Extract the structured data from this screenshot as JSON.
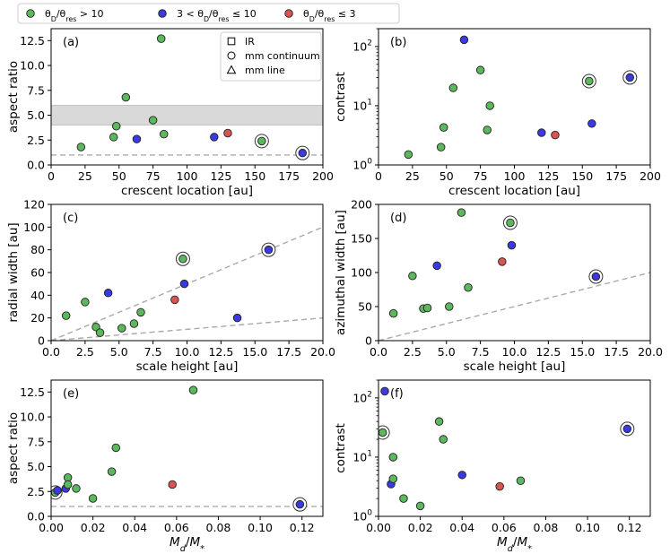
{
  "legend_top": {
    "entries": [
      {
        "label": "θ_D/θ_res > 10",
        "parts": [
          [
            "θ",
            ""
          ],
          [
            "D",
            "sub"
          ],
          [
            "/θ",
            ""
          ],
          [
            "res",
            "sub"
          ],
          [
            " > 10",
            ""
          ]
        ],
        "color": "#5cb85c",
        "key": "g"
      },
      {
        "label": "3 < θ_D/θ_res ≤ 10",
        "parts": [
          [
            "3 < θ",
            ""
          ],
          [
            "D",
            "sub"
          ],
          [
            "/θ",
            ""
          ],
          [
            "res",
            "sub"
          ],
          [
            " ≤ 10",
            ""
          ]
        ],
        "color": "#3a3ae0",
        "key": "b"
      },
      {
        "label": "θ_D/θ_res ≤ 3",
        "parts": [
          [
            "θ",
            ""
          ],
          [
            "D",
            "sub"
          ],
          [
            "/θ",
            ""
          ],
          [
            "res",
            "sub"
          ],
          [
            " ≤ 3",
            ""
          ]
        ],
        "color": "#d9534f",
        "key": "r"
      }
    ]
  },
  "legend_markers": {
    "entries": [
      {
        "label": "IR",
        "marker": "square"
      },
      {
        "label": "mm continuum",
        "marker": "circle"
      },
      {
        "label": "mm line",
        "marker": "triangle"
      }
    ]
  },
  "colors": {
    "g": "#5cb85c",
    "b": "#3a3ae0",
    "r": "#d9534f",
    "edge": "#222222",
    "dashed": "#aaaaaa",
    "band": "#d9d9d9"
  },
  "chart_data": [
    {
      "panel": "(a)",
      "type": "scatter",
      "xlabel": "crescent location [au]",
      "ylabel": "aspect ratio",
      "xlim": [
        0,
        200
      ],
      "ylim": [
        0,
        13.7
      ],
      "yscale": "linear",
      "xticks": [
        0,
        25,
        50,
        75,
        100,
        125,
        150,
        175,
        200
      ],
      "yticks": [
        0,
        2.5,
        5,
        7.5,
        10,
        12.5
      ],
      "xticklabels": [
        "0",
        "25",
        "50",
        "75",
        "100",
        "125",
        "150",
        "175",
        "200"
      ],
      "yticklabels": [
        "0.0",
        "2.5",
        "5.0",
        "7.5",
        "10.0",
        "12.5"
      ],
      "hband": [
        4,
        6
      ],
      "hline": 1,
      "points": [
        {
          "x": 22,
          "y": 1.8,
          "c": "g"
        },
        {
          "x": 46,
          "y": 2.8,
          "c": "g"
        },
        {
          "x": 48,
          "y": 3.9,
          "c": "g"
        },
        {
          "x": 55,
          "y": 6.8,
          "c": "g"
        },
        {
          "x": 63,
          "y": 2.6,
          "c": "b"
        },
        {
          "x": 75,
          "y": 4.5,
          "c": "g"
        },
        {
          "x": 81,
          "y": 12.7,
          "c": "g"
        },
        {
          "x": 83,
          "y": 3.1,
          "c": "g"
        },
        {
          "x": 120,
          "y": 2.8,
          "c": "b"
        },
        {
          "x": 130,
          "y": 3.2,
          "c": "r"
        },
        {
          "x": 155,
          "y": 2.4,
          "c": "g",
          "ring": true
        },
        {
          "x": 185,
          "y": 1.2,
          "c": "b",
          "ring": true
        }
      ]
    },
    {
      "panel": "(b)",
      "type": "scatter",
      "xlabel": "crescent location [au]",
      "ylabel": "contrast",
      "xlim": [
        0,
        200
      ],
      "ylim": [
        1,
        200
      ],
      "yscale": "log",
      "xticks": [
        0,
        25,
        50,
        75,
        100,
        125,
        150,
        175,
        200
      ],
      "xticklabels": [
        "0",
        "25",
        "50",
        "75",
        "100",
        "125",
        "150",
        "175",
        "200"
      ],
      "yticks": [
        1,
        10,
        100
      ],
      "yticklabels": [
        [
          "10",
          "0"
        ],
        [
          "10",
          "1"
        ],
        [
          "10",
          "2"
        ]
      ],
      "points": [
        {
          "x": 22,
          "y": 1.5,
          "c": "g"
        },
        {
          "x": 46,
          "y": 2.0,
          "c": "g"
        },
        {
          "x": 48,
          "y": 4.3,
          "c": "g"
        },
        {
          "x": 55,
          "y": 20,
          "c": "g"
        },
        {
          "x": 63,
          "y": 130,
          "c": "b"
        },
        {
          "x": 75,
          "y": 40,
          "c": "g"
        },
        {
          "x": 80,
          "y": 3.9,
          "c": "g"
        },
        {
          "x": 82,
          "y": 10,
          "c": "g"
        },
        {
          "x": 120,
          "y": 3.5,
          "c": "b"
        },
        {
          "x": 130,
          "y": 3.2,
          "c": "r"
        },
        {
          "x": 155,
          "y": 26,
          "c": "g",
          "ring": true
        },
        {
          "x": 157,
          "y": 5.0,
          "c": "b"
        },
        {
          "x": 185,
          "y": 30,
          "c": "b",
          "ring": true
        }
      ]
    },
    {
      "panel": "(c)",
      "type": "scatter",
      "xlabel": "scale height [au]",
      "ylabel": "radial width [au]",
      "xlim": [
        0,
        20
      ],
      "ylim": [
        0,
        120
      ],
      "yscale": "linear",
      "xticks": [
        0,
        2.5,
        5,
        7.5,
        10,
        12.5,
        15,
        17.5,
        20
      ],
      "xticklabels": [
        "0.0",
        "2.5",
        "5.0",
        "7.5",
        "10.0",
        "12.5",
        "15.0",
        "17.5",
        "20.0"
      ],
      "yticks": [
        0,
        20,
        40,
        60,
        80,
        100,
        120
      ],
      "yticklabels": [
        "0",
        "20",
        "40",
        "60",
        "80",
        "100",
        "120"
      ],
      "lines": [
        [
          [
            0,
            0
          ],
          [
            20,
            100
          ]
        ],
        [
          [
            0,
            0
          ],
          [
            20,
            20
          ]
        ]
      ],
      "points": [
        {
          "x": 1.1,
          "y": 22,
          "c": "g"
        },
        {
          "x": 2.5,
          "y": 34,
          "c": "g"
        },
        {
          "x": 3.3,
          "y": 12,
          "c": "g"
        },
        {
          "x": 3.6,
          "y": 7,
          "c": "g"
        },
        {
          "x": 4.2,
          "y": 42,
          "c": "b"
        },
        {
          "x": 5.2,
          "y": 11,
          "c": "g"
        },
        {
          "x": 6.1,
          "y": 15,
          "c": "g"
        },
        {
          "x": 6.6,
          "y": 25,
          "c": "g"
        },
        {
          "x": 9.1,
          "y": 36,
          "c": "r"
        },
        {
          "x": 9.7,
          "y": 72,
          "c": "g",
          "ring": true
        },
        {
          "x": 9.8,
          "y": 50,
          "c": "b"
        },
        {
          "x": 13.7,
          "y": 20,
          "c": "b"
        },
        {
          "x": 16.0,
          "y": 80,
          "c": "b",
          "ring": true
        }
      ]
    },
    {
      "panel": "(d)",
      "type": "scatter",
      "xlabel": "scale height [au]",
      "ylabel": "azimuthal width [au]",
      "xlim": [
        0,
        20
      ],
      "ylim": [
        0,
        200
      ],
      "yscale": "linear",
      "xticks": [
        0,
        2.5,
        5,
        7.5,
        10,
        12.5,
        15,
        17.5,
        20
      ],
      "xticklabels": [
        "0.0",
        "2.5",
        "5.0",
        "7.5",
        "10.0",
        "12.5",
        "15.0",
        "17.5",
        "20.0"
      ],
      "yticks": [
        0,
        50,
        100,
        150,
        200
      ],
      "yticklabels": [
        "0",
        "50",
        "100",
        "150",
        "200"
      ],
      "lines": [
        [
          [
            0,
            0
          ],
          [
            20,
            100
          ]
        ]
      ],
      "points": [
        {
          "x": 1.1,
          "y": 40,
          "c": "g"
        },
        {
          "x": 2.5,
          "y": 95,
          "c": "g"
        },
        {
          "x": 3.3,
          "y": 47,
          "c": "g"
        },
        {
          "x": 3.6,
          "y": 48,
          "c": "g"
        },
        {
          "x": 4.3,
          "y": 110,
          "c": "b"
        },
        {
          "x": 5.2,
          "y": 50,
          "c": "g"
        },
        {
          "x": 6.1,
          "y": 188,
          "c": "g"
        },
        {
          "x": 6.6,
          "y": 78,
          "c": "g"
        },
        {
          "x": 9.1,
          "y": 116,
          "c": "r"
        },
        {
          "x": 9.7,
          "y": 173,
          "c": "g",
          "ring": true
        },
        {
          "x": 9.8,
          "y": 140,
          "c": "b"
        },
        {
          "x": 16.0,
          "y": 94,
          "c": "b",
          "ring": true
        }
      ]
    },
    {
      "panel": "(e)",
      "type": "scatter",
      "xlabel_parts": [
        [
          "M",
          "it"
        ],
        [
          "d",
          "sub-it"
        ],
        [
          "/",
          ""
        ],
        [
          "M",
          "it"
        ],
        [
          "*",
          "sub"
        ]
      ],
      "xlabel": "M_d/M_*",
      "ylabel": "aspect ratio",
      "xlim": [
        0,
        0.13
      ],
      "ylim": [
        0,
        13.7
      ],
      "yscale": "linear",
      "xticks": [
        0,
        0.02,
        0.04,
        0.06,
        0.08,
        0.1,
        0.12
      ],
      "xticklabels": [
        "0.00",
        "0.02",
        "0.04",
        "0.06",
        "0.08",
        "0.10",
        "0.12"
      ],
      "yticks": [
        0,
        2.5,
        5,
        7.5,
        10,
        12.5
      ],
      "yticklabels": [
        "0.0",
        "2.5",
        "5.0",
        "7.5",
        "10.0",
        "12.5"
      ],
      "hline": 1,
      "points": [
        {
          "x": 0.002,
          "y": 2.4,
          "c": "g",
          "ring": true
        },
        {
          "x": 0.003,
          "y": 2.6,
          "c": "b"
        },
        {
          "x": 0.007,
          "y": 2.8,
          "c": "b"
        },
        {
          "x": 0.008,
          "y": 3.9,
          "c": "g"
        },
        {
          "x": 0.008,
          "y": 3.2,
          "c": "g"
        },
        {
          "x": 0.012,
          "y": 2.8,
          "c": "g"
        },
        {
          "x": 0.02,
          "y": 1.8,
          "c": "g"
        },
        {
          "x": 0.029,
          "y": 4.5,
          "c": "g"
        },
        {
          "x": 0.031,
          "y": 6.9,
          "c": "g"
        },
        {
          "x": 0.058,
          "y": 3.2,
          "c": "r"
        },
        {
          "x": 0.068,
          "y": 12.7,
          "c": "g"
        },
        {
          "x": 0.119,
          "y": 1.2,
          "c": "b",
          "ring": true
        }
      ]
    },
    {
      "panel": "(f)",
      "type": "scatter",
      "xlabel_parts": [
        [
          "M",
          "it"
        ],
        [
          "d",
          "sub-it"
        ],
        [
          "/",
          ""
        ],
        [
          "M",
          "it"
        ],
        [
          "*",
          "sub"
        ]
      ],
      "xlabel": "M_d/M_*",
      "ylabel": "contrast",
      "xlim": [
        0,
        0.13
      ],
      "ylim": [
        1,
        200
      ],
      "yscale": "log",
      "xticks": [
        0,
        0.02,
        0.04,
        0.06,
        0.08,
        0.1,
        0.12
      ],
      "xticklabels": [
        "0.00",
        "0.02",
        "0.04",
        "0.06",
        "0.08",
        "0.10",
        "0.12"
      ],
      "yticks": [
        1,
        10,
        100
      ],
      "yticklabels": [
        [
          "10",
          "0"
        ],
        [
          "10",
          "1"
        ],
        [
          "10",
          "2"
        ]
      ],
      "points": [
        {
          "x": 0.002,
          "y": 26,
          "c": "g",
          "ring": true
        },
        {
          "x": 0.003,
          "y": 130,
          "c": "b"
        },
        {
          "x": 0.006,
          "y": 3.5,
          "c": "b"
        },
        {
          "x": 0.007,
          "y": 4.3,
          "c": "g"
        },
        {
          "x": 0.007,
          "y": 10,
          "c": "g"
        },
        {
          "x": 0.012,
          "y": 2.0,
          "c": "g"
        },
        {
          "x": 0.02,
          "y": 1.5,
          "c": "g"
        },
        {
          "x": 0.029,
          "y": 40,
          "c": "g"
        },
        {
          "x": 0.031,
          "y": 20,
          "c": "g"
        },
        {
          "x": 0.04,
          "y": 5.0,
          "c": "b"
        },
        {
          "x": 0.058,
          "y": 3.2,
          "c": "r"
        },
        {
          "x": 0.068,
          "y": 4.0,
          "c": "g"
        },
        {
          "x": 0.119,
          "y": 30,
          "c": "b",
          "ring": true
        }
      ]
    }
  ]
}
